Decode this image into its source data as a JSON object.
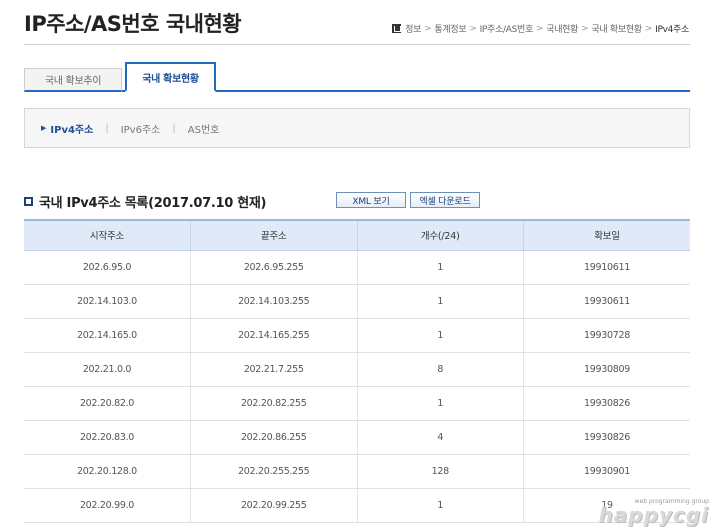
{
  "page": {
    "title": "IP주소/AS번호 국내현황"
  },
  "breadcrumb": {
    "items": [
      "정보",
      "통계정보",
      "IP주소/AS번호",
      "국내현황",
      "국내 확보현황",
      "IPv4주소"
    ],
    "separator": ">"
  },
  "tabs": [
    {
      "label": "국내 확보추이",
      "active": false
    },
    {
      "label": "국내 확보현황",
      "active": true
    }
  ],
  "subnav": [
    {
      "label": "IPv4주소",
      "active": true
    },
    {
      "label": "IPv6주소",
      "active": false
    },
    {
      "label": "AS번호",
      "active": false
    }
  ],
  "list": {
    "title": "국내 IPv4주소 목록(2017.07.10 현재)",
    "xml_button": "XML 보기",
    "excel_button": "엑셀 다운로드"
  },
  "table": {
    "headers": [
      "시작주소",
      "끝주소",
      "개수(/24)",
      "확보일"
    ],
    "rows": [
      [
        "202.6.95.0",
        "202.6.95.255",
        "1",
        "19910611"
      ],
      [
        "202.14.103.0",
        "202.14.103.255",
        "1",
        "19930611"
      ],
      [
        "202.14.165.0",
        "202.14.165.255",
        "1",
        "19930728"
      ],
      [
        "202.21.0.0",
        "202.21.7.255",
        "8",
        "19930809"
      ],
      [
        "202.20.82.0",
        "202.20.82.255",
        "1",
        "19930826"
      ],
      [
        "202.20.83.0",
        "202.20.86.255",
        "4",
        "19930826"
      ],
      [
        "202.20.128.0",
        "202.20.255.255",
        "128",
        "19930901"
      ],
      [
        "202.20.99.0",
        "202.20.99.255",
        "1",
        "19"
      ]
    ]
  },
  "watermark": {
    "tagline": "web programming group",
    "logo": "happycgi"
  },
  "colors": {
    "accent": "#1e6bbf",
    "header_bg": "#dfe9f7"
  }
}
